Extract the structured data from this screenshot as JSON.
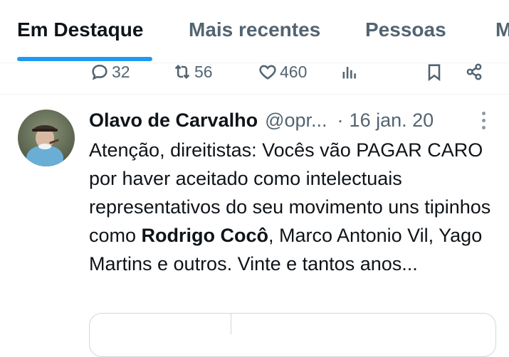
{
  "tabs": [
    {
      "label": "Em Destaque",
      "active": true
    },
    {
      "label": "Mais recentes",
      "active": false
    },
    {
      "label": "Pessoas",
      "active": false
    },
    {
      "label": "M",
      "active": false
    }
  ],
  "prev_tweet_actions": {
    "replies": "32",
    "reposts": "56",
    "likes": "460"
  },
  "tweet": {
    "name": "Olavo de Carvalho",
    "handle": "@opr...",
    "separator": "·",
    "date": "16 jan. 20",
    "text_part1": "Atenção, direitistas: Vocês vão PAGAR CARO por haver aceitado como intelectuais representativos do seu movimento uns tipinhos como ",
    "text_bold": "Rodrigo Cocô",
    "text_part2": ", Marco Antonio Vil, Yago Martins e outros. Vinte e tantos anos..."
  },
  "colors": {
    "accent": "#1d9bf0",
    "text_primary": "#0f1419",
    "text_secondary": "#536471"
  }
}
